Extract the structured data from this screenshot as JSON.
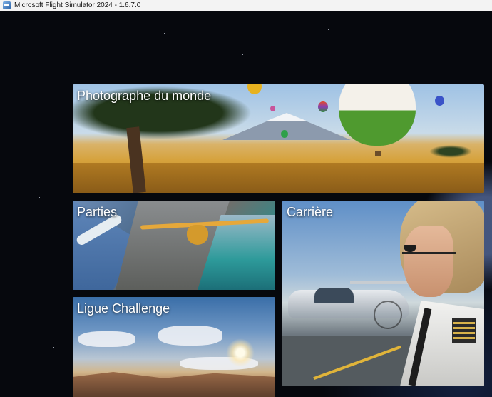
{
  "window": {
    "title": "Microsoft Flight Simulator 2024 - 1.6.7.0"
  },
  "tiles": {
    "photo": "Photographe du monde",
    "parties": "Parties",
    "carriere": "Carrière",
    "ligue": "Ligue Challenge"
  },
  "colors": {
    "background": "#06080d",
    "titlebar": "#f3f3f3",
    "label": "#ffffff"
  },
  "icons": {
    "app": "flight-simulator-icon"
  }
}
